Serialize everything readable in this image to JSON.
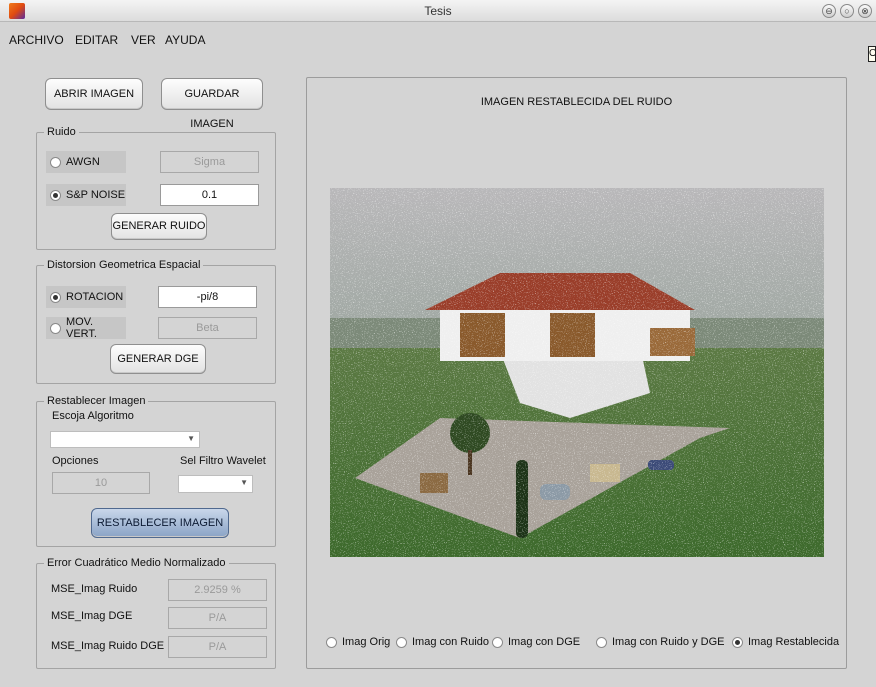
{
  "window": {
    "title": "Tesis",
    "controls": [
      "⊖",
      "○",
      "⊗"
    ],
    "edge_marker": "O"
  },
  "menu": [
    "ARCHIVO",
    "EDITAR",
    "VER",
    "AYUDA"
  ],
  "buttons": {
    "open": "ABRIR IMAGEN",
    "save": "GUARDAR IMAGEN"
  },
  "noise": {
    "title": "Ruido",
    "awgn_label": "AWGN",
    "awgn_placeholder": "Sigma",
    "sp_label": "S&P NOISE",
    "sp_value": "0.1",
    "generate": "GENERAR RUIDO",
    "selected": "S&P NOISE"
  },
  "dge": {
    "title": "Distorsion Geometrica Espacial",
    "rotation_label": "ROTACION",
    "rotation_value": "-pi/8",
    "vertical_label": "MOV. VERT.",
    "vertical_placeholder": "Beta",
    "generate": "GENERAR DGE",
    "selected": "ROTACION"
  },
  "restore": {
    "title": "Restablecer Imagen",
    "algorithm_label": "Escoja Algoritmo",
    "options_label": "Opciones",
    "options_value": "10",
    "wavelet_label": "Sel Filtro Wavelet",
    "button": "RESTABLECER IMAGEN"
  },
  "error": {
    "title": "Error Cuadrático Medio Normalizado",
    "rows": [
      {
        "label": "MSE_Imag Ruido",
        "value": "2.9259 %"
      },
      {
        "label": "MSE_Imag DGE",
        "value": "P/A"
      },
      {
        "label": "MSE_Imag Ruido DGE",
        "value": "P/A"
      }
    ]
  },
  "main": {
    "image_title": "IMAGEN RESTABLECIDA DEL RUIDO",
    "view_options": [
      "Imag Orig",
      "Imag con Ruido",
      "Imag con DGE",
      "Imag con Ruido y DGE",
      "Imag Restablecida"
    ],
    "selected_view": "Imag Restablecida"
  }
}
